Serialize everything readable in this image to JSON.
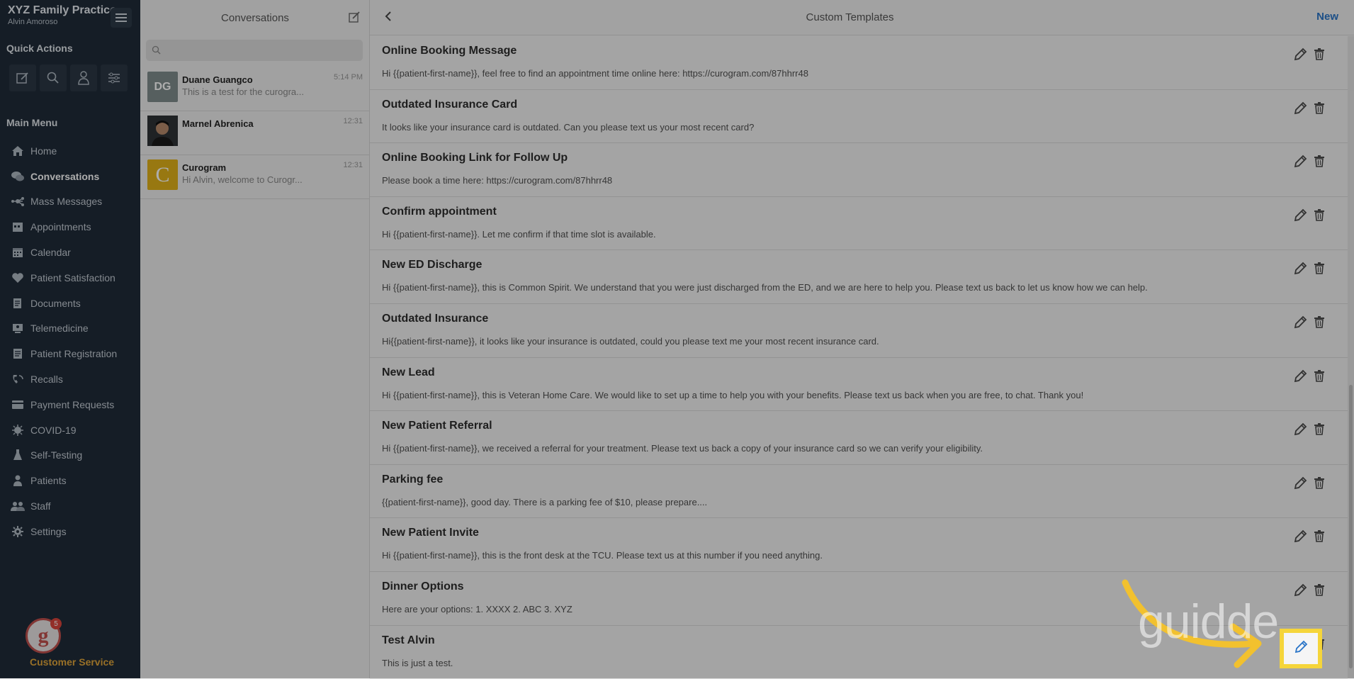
{
  "brand": {
    "practice": "XYZ Family Practice",
    "user": "Alvin Amoroso"
  },
  "quick_actions": {
    "title": "Quick Actions",
    "icons": [
      "compose-icon",
      "search-icon",
      "patient-icon",
      "filter-icon"
    ]
  },
  "main_menu": {
    "title": "Main Menu",
    "items": [
      {
        "label": "Home",
        "icon": "home-icon"
      },
      {
        "label": "Conversations",
        "icon": "chat-icon",
        "active": true
      },
      {
        "label": "Mass Messages",
        "icon": "broadcast-icon"
      },
      {
        "label": "Appointments",
        "icon": "appointments-icon"
      },
      {
        "label": "Calendar",
        "icon": "calendar-icon"
      },
      {
        "label": "Patient Satisfaction",
        "icon": "heart-icon"
      },
      {
        "label": "Documents",
        "icon": "documents-icon"
      },
      {
        "label": "Telemedicine",
        "icon": "telemedicine-icon"
      },
      {
        "label": "Patient Registration",
        "icon": "registration-icon"
      },
      {
        "label": "Recalls",
        "icon": "recalls-icon"
      },
      {
        "label": "Payment Requests",
        "icon": "payment-icon"
      },
      {
        "label": "COVID-19",
        "icon": "virus-icon"
      },
      {
        "label": "Self-Testing",
        "icon": "flask-icon"
      },
      {
        "label": "Patients",
        "icon": "person-icon"
      },
      {
        "label": "Staff",
        "icon": "staff-icon"
      },
      {
        "label": "Settings",
        "icon": "gear-icon"
      }
    ]
  },
  "customer_service": {
    "label": "Customer Service",
    "badge": "5",
    "logo_letter": "g"
  },
  "conversations": {
    "title": "Conversations",
    "items": [
      {
        "name": "Duane Guangco",
        "preview": "This is a test for the curogra...",
        "time": "5:14 PM",
        "initials": "DG",
        "color": "#7f8c8d"
      },
      {
        "name": "Marnel Abrenica",
        "preview": "",
        "time": "12:31",
        "initials": "",
        "color": "#4a4a4a"
      },
      {
        "name": "Curogram",
        "preview": "Hi Alvin, welcome to Curogr...",
        "time": "12:31",
        "initials": "C",
        "color": "#e0b21a"
      }
    ]
  },
  "main": {
    "title": "Custom Templates",
    "new_label": "New",
    "templates": [
      {
        "title": "Online Booking Message",
        "body": "Hi {{patient-first-name}}, feel free to find an appointment time online here: https://curogram.com/87hhrr48"
      },
      {
        "title": "Outdated Insurance Card",
        "body": "It looks like your insurance card is outdated. Can you please text us your most recent card?"
      },
      {
        "title": "Online Booking Link for Follow Up",
        "body": "Please book a time here: https://curogram.com/87hhrr48"
      },
      {
        "title": "Confirm appointment",
        "body": "Hi {{patient-first-name}}. Let me confirm if that time slot is available."
      },
      {
        "title": "New ED Discharge",
        "body": "Hi {{patient-first-name}}, this is Common Spirit. We understand that you were just discharged from the ED, and we are here to help you. Please text us back to let us know how we can help."
      },
      {
        "title": "Outdated Insurance",
        "body": "Hi{{patient-first-name}}, it looks like your insurance is outdated, could you please text me your most recent insurance card."
      },
      {
        "title": "New Lead",
        "body": "Hi {{patient-first-name}}, this is Veteran Home Care. We would like to set up a time to help you with your benefits. Please text us back when you are free, to chat. Thank you!"
      },
      {
        "title": "New Patient Referral",
        "body": "Hi {{patient-first-name}}, we received a referral for your treatment. Please text us back a copy of your insurance card so we can verify your eligibility."
      },
      {
        "title": "Parking fee",
        "body": "{{patient-first-name}}, good day. There is a parking fee of $10, please prepare...."
      },
      {
        "title": "New Patient Invite",
        "body": "Hi {{patient-first-name}}, this is the front desk at the TCU. Please text us at this number if you need anything."
      },
      {
        "title": "Dinner Options",
        "body": "Here are your options: 1. XXXX 2. ABC 3. XYZ"
      },
      {
        "title": "Test Alvin",
        "body": "This is just a test."
      }
    ]
  },
  "watermark": "guidde."
}
